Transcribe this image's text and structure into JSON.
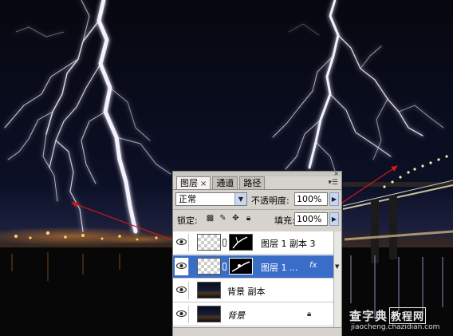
{
  "panel": {
    "tabs": [
      {
        "label": "图层",
        "active": true,
        "close": "×"
      },
      {
        "label": "通道",
        "active": false
      },
      {
        "label": "路径",
        "active": false
      }
    ],
    "close_glyph": "×",
    "menu_glyph": "▾☰",
    "blend_mode": "正常",
    "opacity_label": "不透明度:",
    "opacity_value": "100%",
    "lock_label": "锁定:",
    "fill_label": "填充:",
    "fill_value": "100%",
    "layers": [
      {
        "name": "图层 1 副本 3",
        "selected": false,
        "has_mask": true,
        "italic": false
      },
      {
        "name": "图层 1 ...",
        "selected": true,
        "has_mask": true,
        "fx": "fx",
        "italic": false
      },
      {
        "name": "背景 副本",
        "selected": false,
        "has_mask": false,
        "italic": false
      },
      {
        "name": "背景",
        "selected": false,
        "has_mask": false,
        "italic": true,
        "locked": true
      }
    ]
  },
  "watermark": {
    "main": "查字典",
    "box": "教程网",
    "url": "jiaocheng.chazidian.com"
  },
  "colors": {
    "panel_bg": "#d6d3ce",
    "selection": "#3a6dc8",
    "annotation_arrow": "#d01818",
    "lightning": "#f4f1ff",
    "night_sky": "#06070f"
  }
}
